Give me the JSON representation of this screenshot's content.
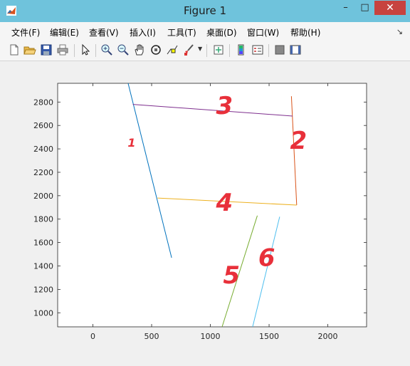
{
  "window": {
    "title": "Figure 1"
  },
  "menu": [
    "文件(F)",
    "编辑(E)",
    "查看(V)",
    "插入(I)",
    "工具(T)",
    "桌面(D)",
    "窗口(W)",
    "帮助(H)"
  ],
  "toolbar_icons": [
    "new-figure-icon",
    "open-file-icon",
    "save-icon",
    "print-icon",
    "pointer-icon",
    "zoom-in-icon",
    "zoom-out-icon",
    "pan-icon",
    "rotate-3d-icon",
    "data-cursor-icon",
    "brush-icon",
    "link-plot-icon",
    "colorbar-icon",
    "legend-icon",
    "hide-plot-tools-icon",
    "show-plot-tools-icon"
  ],
  "chart_data": {
    "type": "line",
    "xlim": [
      -300,
      2330
    ],
    "ylim": [
      880,
      2960
    ],
    "xticks": [
      "0",
      "500",
      "1000",
      "1500",
      "2000"
    ],
    "xtick_values": [
      0,
      500,
      1000,
      1500,
      2000
    ],
    "yticks": [
      "1000",
      "1200",
      "1400",
      "1600",
      "1800",
      "2000",
      "2200",
      "2400",
      "2600",
      "2800"
    ],
    "ytick_values": [
      1000,
      1200,
      1400,
      1600,
      1800,
      2000,
      2200,
      2400,
      2600,
      2800
    ],
    "grid": false,
    "series": [
      {
        "color": "#0072bd",
        "x": [
          300,
          670
        ],
        "y": [
          2960,
          1470
        ]
      },
      {
        "color": "#d95319",
        "x": [
          1690,
          1735
        ],
        "y": [
          2850,
          1920
        ]
      },
      {
        "color": "#7e2f8e",
        "x": [
          340,
          1700
        ],
        "y": [
          2780,
          2680
        ]
      },
      {
        "color": "#edb120",
        "x": [
          550,
          1735
        ],
        "y": [
          1980,
          1920
        ]
      },
      {
        "color": "#77ac30",
        "x": [
          1100,
          1400
        ],
        "y": [
          880,
          1830
        ]
      },
      {
        "color": "#4dbeee",
        "x": [
          1360,
          1590
        ],
        "y": [
          880,
          1820
        ]
      }
    ],
    "annotations": [
      {
        "text": "1",
        "x": 330,
        "y": 2420
      },
      {
        "text": "2",
        "x": 1750,
        "y": 2400
      },
      {
        "text": "3",
        "x": 1120,
        "y": 2700
      },
      {
        "text": "4",
        "x": 1120,
        "y": 1870
      },
      {
        "text": "5",
        "x": 1180,
        "y": 1250
      },
      {
        "text": "6",
        "x": 1480,
        "y": 1400
      }
    ]
  }
}
